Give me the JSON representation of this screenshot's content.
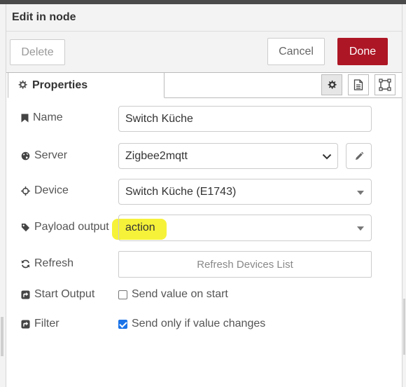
{
  "dialog": {
    "title": "Edit in node"
  },
  "toolbar": {
    "delete_label": "Delete",
    "cancel_label": "Cancel",
    "done_label": "Done"
  },
  "tabs": [
    {
      "label": "Properties",
      "icon": "gear-icon"
    }
  ],
  "tab_icons": [
    "gear-icon",
    "document-icon",
    "frame-icon"
  ],
  "fields": {
    "name": {
      "label": "Name",
      "value": "Switch Küche",
      "icon": "bookmark-icon"
    },
    "server": {
      "label": "Server",
      "value": "Zigbee2mqtt",
      "icon": "globe-icon"
    },
    "device": {
      "label": "Device",
      "value": "Switch Küche (E1743)",
      "icon": "crosshair-icon"
    },
    "payload_output": {
      "label": "Payload output",
      "value": "action",
      "icon": "tag-icon"
    },
    "refresh": {
      "label": "Refresh",
      "button_label": "Refresh Devices List",
      "icon": "refresh-icon"
    },
    "start_output": {
      "label": "Start Output",
      "checkbox_label": "Send value on start",
      "checked": false,
      "icon": "external-link-icon"
    },
    "filter": {
      "label": "Filter",
      "checkbox_label": "Send only if value changes",
      "checked": true,
      "icon": "external-link-icon"
    }
  },
  "colors": {
    "done": "#ad1625",
    "highlight": "#f6f23a",
    "checkbox": "#1a73e8"
  }
}
